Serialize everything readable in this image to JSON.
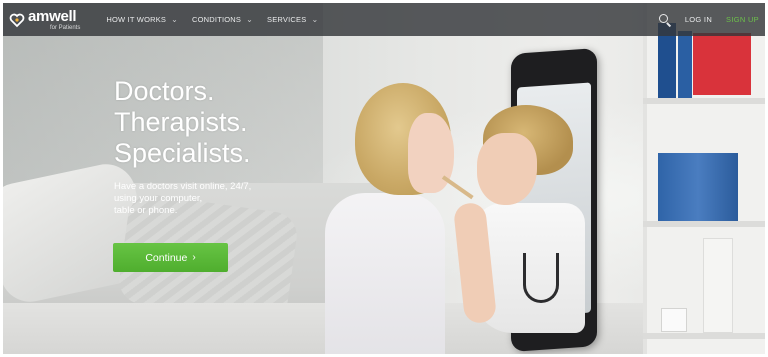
{
  "brand": {
    "logo_text": "amwell",
    "logo_subtext": "for Patients"
  },
  "nav": {
    "items": [
      {
        "label": "HOW IT WORKS"
      },
      {
        "label": "CONDITIONS"
      },
      {
        "label": "SERVICES"
      }
    ],
    "login_label": "LOG IN",
    "signup_label": "SIGN UP"
  },
  "hero": {
    "headline_lines": [
      "Doctors.",
      "Therapists.",
      "Specialists."
    ],
    "subtext_lines": [
      "Have a doctors visit online, 24/7,",
      "using your computer,",
      "table or phone."
    ],
    "cta_label": "Continue"
  },
  "colors": {
    "nav_bg": "#34373A",
    "signup_green": "#6CC04A",
    "cta_green": "#5AB839"
  },
  "icons": {
    "logo": "heart-logo-icon",
    "search": "search-icon",
    "dropdown": "chevron-down-icon",
    "cta": "chevron-right-icon"
  }
}
